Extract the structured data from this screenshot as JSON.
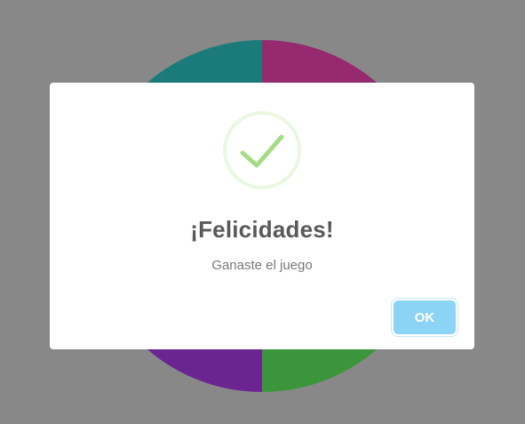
{
  "colors": {
    "backdrop": "#888888",
    "wheel_segments": [
      "#1b7b7b",
      "#952a6f",
      "#3b963b",
      "#6a2591"
    ],
    "success_green": "#a5dc86",
    "success_ring": "#eaf7e1",
    "ok_button_bg": "#8cd4f5",
    "title_text": "#595959",
    "body_text": "#797979"
  },
  "wheel": {
    "segment_count": 4
  },
  "dialog": {
    "icon": "success-check-icon",
    "title": "¡Felicidades!",
    "text": "Ganaste el juego",
    "confirm_label": "OK"
  }
}
